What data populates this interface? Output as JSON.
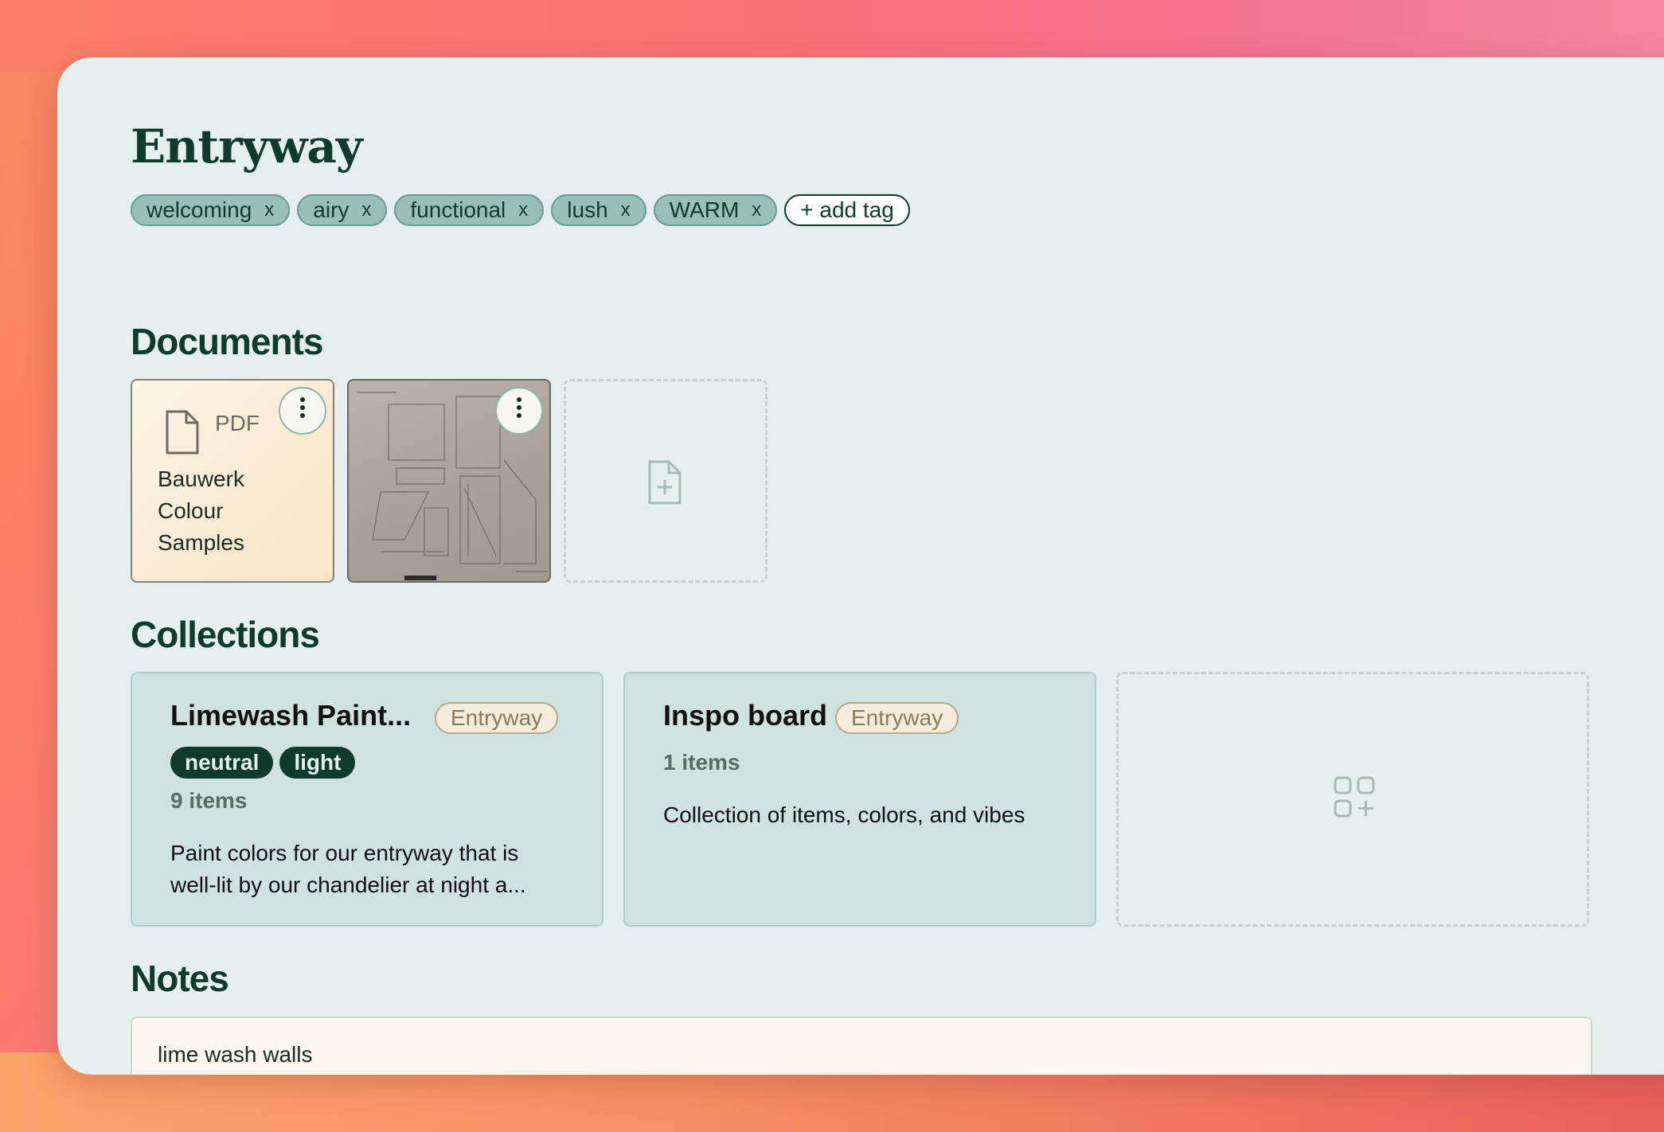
{
  "page": {
    "title": "Entryway"
  },
  "tags": [
    {
      "label": "welcoming",
      "remove": "x"
    },
    {
      "label": "airy",
      "remove": "x"
    },
    {
      "label": "functional",
      "remove": "x"
    },
    {
      "label": "lush",
      "remove": "x"
    },
    {
      "label": "WARM",
      "remove": "x"
    }
  ],
  "add_tag_label": "+ add tag",
  "sections": {
    "documents": "Documents",
    "collections": "Collections",
    "notes": "Notes"
  },
  "documents": [
    {
      "type_label": "PDF",
      "title": "Bauwerk Colour Samples",
      "icon": "file-icon",
      "menu": "more-vertical-icon"
    },
    {
      "type": "image",
      "icon": "sketch-thumbnail",
      "menu": "more-vertical-icon"
    }
  ],
  "collections": [
    {
      "title": "Limewash Paint...",
      "location": "Entryway",
      "tags": [
        "neutral",
        "light"
      ],
      "count": "9 items",
      "description": "Paint colors for our entryway that is well-lit by our chandelier at night a..."
    },
    {
      "title": "Inspo board",
      "location": "Entryway",
      "count": "1 items",
      "description": "Collection of items, colors, and vibes"
    }
  ],
  "notes": [
    {
      "text": "lime wash walls"
    }
  ],
  "colors": {
    "accent": "#0f3a2c",
    "tag_bg": "#98c0b4",
    "window_bg": "#e5efed",
    "collection_bg": "#cfe2de",
    "pdf_card_bg": "#f6e3c4"
  }
}
